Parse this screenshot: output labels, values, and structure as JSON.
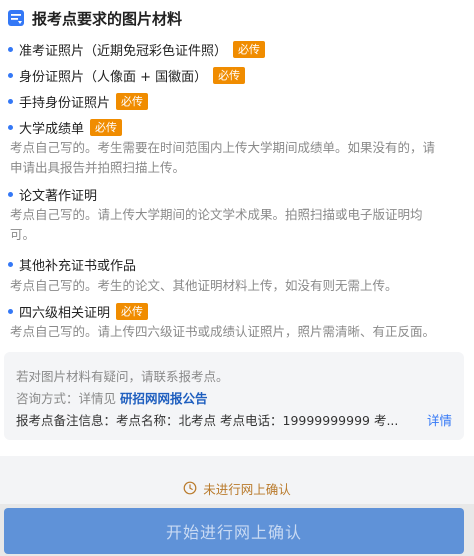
{
  "header": {
    "title": "报考点要求的图片材料",
    "icon": "document-icon"
  },
  "badge_label": "必传",
  "requirements": [
    {
      "title": "准考证照片（近期免冠彩色证件照）"
    },
    {
      "title": "身份证照片（人像面 + 国徽面）"
    },
    {
      "title": "手持身份证照片"
    },
    {
      "title": "大学成绩单",
      "desc": [
        "考点自己写的。考生需要在时间范围内上传大学期间成绩单。如果没有的，请",
        "申请出具报告并拍照扫描上传。"
      ]
    },
    {
      "title": "论文著作证明",
      "desc": [
        "考点自己写的。请上传大学期间的论文学术成果。拍照扫描或电子版证明均",
        "可。"
      ]
    },
    {
      "title": "其他补充证书或作品",
      "desc": [
        "考点自己写的。考生的论文、其他证明材料上传，如没有则无需上传。"
      ]
    },
    {
      "title": "四六级相关证明",
      "desc": [
        "考点自己写的。请上传四六级证书或成绩认证照片，照片需清晰、有正反面。"
      ]
    }
  ],
  "contact": {
    "note": "若对图片材料有疑问，请联系报考点。",
    "method_prefix": "咨询方式：详情见",
    "method_link": "研招网网报公告",
    "remark_label": "报考点备注信息：",
    "remark_value": "考点名称：北考点 考点电话：19999999999 考...",
    "detail_link": "详情"
  },
  "status": {
    "text": "未进行网上确认",
    "icon": "clock-icon",
    "color": "#b97a2b"
  },
  "confirm_button": {
    "label": "开始进行网上确认"
  },
  "colors": {
    "accent": "#3478f6",
    "badge": "#f08c00",
    "button": "#5f92d8"
  }
}
